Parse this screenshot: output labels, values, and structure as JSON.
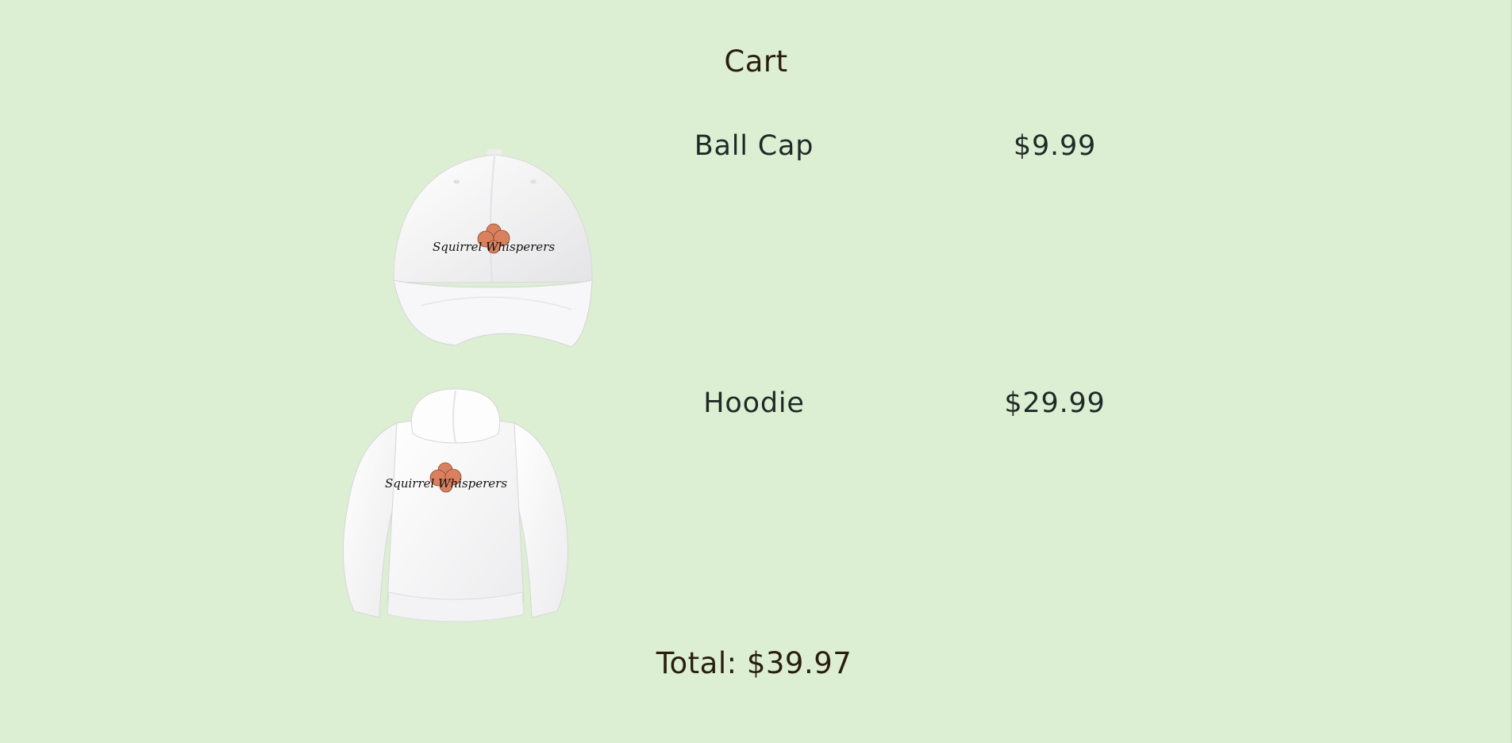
{
  "page": {
    "title": "Cart",
    "background_color": "#ddefd2"
  },
  "items": [
    {
      "name": "Ball Cap",
      "price": "$9.99",
      "image_icon": "ball-cap-image",
      "logo_text": "Squirrel Whisperers"
    },
    {
      "name": "Hoodie",
      "price": "$29.99",
      "image_icon": "hoodie-image",
      "logo_text": "Squirrel Whisperers"
    }
  ],
  "total": {
    "text": "Total: $39.97"
  },
  "colors": {
    "logo_accent": "#d9805f",
    "text": "#1f2a28"
  }
}
